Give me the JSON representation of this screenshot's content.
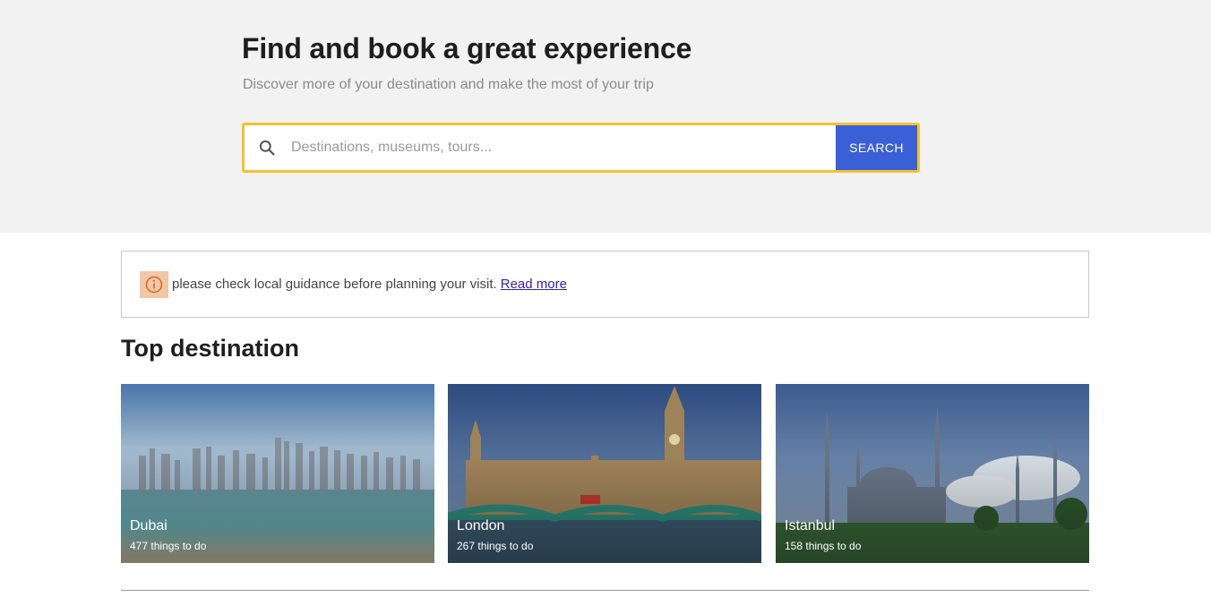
{
  "hero": {
    "title": "Find and book a great experience",
    "subtitle": "Discover more of your destination and make the most of your trip"
  },
  "search": {
    "placeholder": "Destinations, museums, tours...",
    "button_label": "SEARCH",
    "icon": "search-icon",
    "accent_border": "#f1c232",
    "button_color": "#3b5fd6"
  },
  "notice": {
    "icon": "info-icon",
    "text": "please check local guidance before planning your visit.",
    "link_text": "Read more"
  },
  "top_destination": {
    "title": "Top destination",
    "cards": [
      {
        "name": "Dubai",
        "count": "477 things to do"
      },
      {
        "name": "London",
        "count": "267 things to do"
      },
      {
        "name": "Istanbul",
        "count": "158 things to do"
      }
    ]
  }
}
